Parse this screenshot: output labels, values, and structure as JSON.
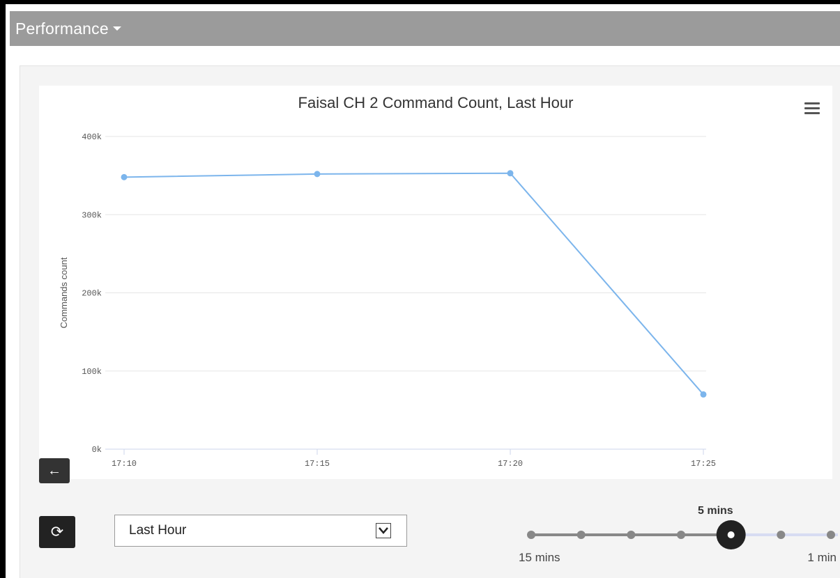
{
  "header": {
    "title": "Performance"
  },
  "chart_data": {
    "type": "line",
    "title": "Faisal CH 2 Command Count, Last Hour",
    "xlabel": "",
    "ylabel": "Commands count",
    "categories": [
      "17:10",
      "17:15",
      "17:20",
      "17:25"
    ],
    "series": [
      {
        "values": [
          348000,
          352000,
          353000,
          70000
        ]
      }
    ],
    "ylim": [
      0,
      400000
    ],
    "yticks": [
      "0k",
      "100k",
      "200k",
      "300k",
      "400k"
    ],
    "grid": true,
    "color": "#7cb5ec"
  },
  "controls": {
    "range_select": {
      "value": "Last Hour",
      "options": [
        "Last Hour"
      ]
    },
    "interval": {
      "selected_label": "5 mins",
      "min_label": "15 mins",
      "max_label": "1 min",
      "steps": 7,
      "selected_index": 4
    }
  },
  "icons": {
    "menu": "hamburger-menu-icon",
    "back": "arrow-left-icon",
    "refresh": "refresh-icon",
    "dropdown": "chevron-down-icon"
  }
}
